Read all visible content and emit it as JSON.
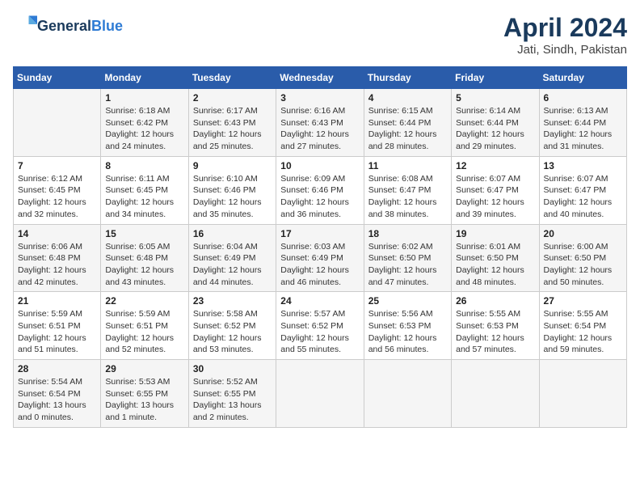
{
  "header": {
    "logo_line1": "General",
    "logo_line2": "Blue",
    "month": "April 2024",
    "location": "Jati, Sindh, Pakistan"
  },
  "weekdays": [
    "Sunday",
    "Monday",
    "Tuesday",
    "Wednesday",
    "Thursday",
    "Friday",
    "Saturday"
  ],
  "weeks": [
    [
      {
        "day": "",
        "info": ""
      },
      {
        "day": "1",
        "info": "Sunrise: 6:18 AM\nSunset: 6:42 PM\nDaylight: 12 hours\nand 24 minutes."
      },
      {
        "day": "2",
        "info": "Sunrise: 6:17 AM\nSunset: 6:43 PM\nDaylight: 12 hours\nand 25 minutes."
      },
      {
        "day": "3",
        "info": "Sunrise: 6:16 AM\nSunset: 6:43 PM\nDaylight: 12 hours\nand 27 minutes."
      },
      {
        "day": "4",
        "info": "Sunrise: 6:15 AM\nSunset: 6:44 PM\nDaylight: 12 hours\nand 28 minutes."
      },
      {
        "day": "5",
        "info": "Sunrise: 6:14 AM\nSunset: 6:44 PM\nDaylight: 12 hours\nand 29 minutes."
      },
      {
        "day": "6",
        "info": "Sunrise: 6:13 AM\nSunset: 6:44 PM\nDaylight: 12 hours\nand 31 minutes."
      }
    ],
    [
      {
        "day": "7",
        "info": "Sunrise: 6:12 AM\nSunset: 6:45 PM\nDaylight: 12 hours\nand 32 minutes."
      },
      {
        "day": "8",
        "info": "Sunrise: 6:11 AM\nSunset: 6:45 PM\nDaylight: 12 hours\nand 34 minutes."
      },
      {
        "day": "9",
        "info": "Sunrise: 6:10 AM\nSunset: 6:46 PM\nDaylight: 12 hours\nand 35 minutes."
      },
      {
        "day": "10",
        "info": "Sunrise: 6:09 AM\nSunset: 6:46 PM\nDaylight: 12 hours\nand 36 minutes."
      },
      {
        "day": "11",
        "info": "Sunrise: 6:08 AM\nSunset: 6:47 PM\nDaylight: 12 hours\nand 38 minutes."
      },
      {
        "day": "12",
        "info": "Sunrise: 6:07 AM\nSunset: 6:47 PM\nDaylight: 12 hours\nand 39 minutes."
      },
      {
        "day": "13",
        "info": "Sunrise: 6:07 AM\nSunset: 6:47 PM\nDaylight: 12 hours\nand 40 minutes."
      }
    ],
    [
      {
        "day": "14",
        "info": "Sunrise: 6:06 AM\nSunset: 6:48 PM\nDaylight: 12 hours\nand 42 minutes."
      },
      {
        "day": "15",
        "info": "Sunrise: 6:05 AM\nSunset: 6:48 PM\nDaylight: 12 hours\nand 43 minutes."
      },
      {
        "day": "16",
        "info": "Sunrise: 6:04 AM\nSunset: 6:49 PM\nDaylight: 12 hours\nand 44 minutes."
      },
      {
        "day": "17",
        "info": "Sunrise: 6:03 AM\nSunset: 6:49 PM\nDaylight: 12 hours\nand 46 minutes."
      },
      {
        "day": "18",
        "info": "Sunrise: 6:02 AM\nSunset: 6:50 PM\nDaylight: 12 hours\nand 47 minutes."
      },
      {
        "day": "19",
        "info": "Sunrise: 6:01 AM\nSunset: 6:50 PM\nDaylight: 12 hours\nand 48 minutes."
      },
      {
        "day": "20",
        "info": "Sunrise: 6:00 AM\nSunset: 6:50 PM\nDaylight: 12 hours\nand 50 minutes."
      }
    ],
    [
      {
        "day": "21",
        "info": "Sunrise: 5:59 AM\nSunset: 6:51 PM\nDaylight: 12 hours\nand 51 minutes."
      },
      {
        "day": "22",
        "info": "Sunrise: 5:59 AM\nSunset: 6:51 PM\nDaylight: 12 hours\nand 52 minutes."
      },
      {
        "day": "23",
        "info": "Sunrise: 5:58 AM\nSunset: 6:52 PM\nDaylight: 12 hours\nand 53 minutes."
      },
      {
        "day": "24",
        "info": "Sunrise: 5:57 AM\nSunset: 6:52 PM\nDaylight: 12 hours\nand 55 minutes."
      },
      {
        "day": "25",
        "info": "Sunrise: 5:56 AM\nSunset: 6:53 PM\nDaylight: 12 hours\nand 56 minutes."
      },
      {
        "day": "26",
        "info": "Sunrise: 5:55 AM\nSunset: 6:53 PM\nDaylight: 12 hours\nand 57 minutes."
      },
      {
        "day": "27",
        "info": "Sunrise: 5:55 AM\nSunset: 6:54 PM\nDaylight: 12 hours\nand 59 minutes."
      }
    ],
    [
      {
        "day": "28",
        "info": "Sunrise: 5:54 AM\nSunset: 6:54 PM\nDaylight: 13 hours\nand 0 minutes."
      },
      {
        "day": "29",
        "info": "Sunrise: 5:53 AM\nSunset: 6:55 PM\nDaylight: 13 hours\nand 1 minute."
      },
      {
        "day": "30",
        "info": "Sunrise: 5:52 AM\nSunset: 6:55 PM\nDaylight: 13 hours\nand 2 minutes."
      },
      {
        "day": "",
        "info": ""
      },
      {
        "day": "",
        "info": ""
      },
      {
        "day": "",
        "info": ""
      },
      {
        "day": "",
        "info": ""
      }
    ]
  ]
}
